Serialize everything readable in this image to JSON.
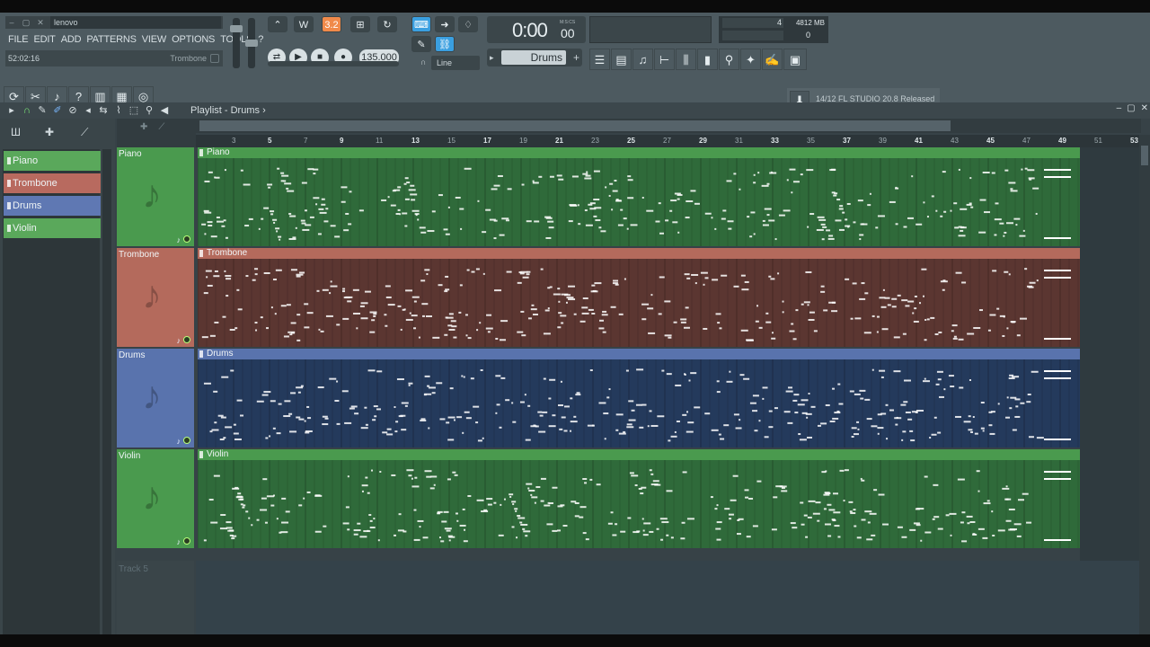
{
  "window": {
    "title": "lenovo",
    "hint_time": "52:02:16",
    "hint_name": "Trombone"
  },
  "menu": [
    "FILE",
    "EDIT",
    "ADD",
    "PATTERNS",
    "VIEW",
    "OPTIONS",
    "TOOLS",
    "?"
  ],
  "transport": {
    "pattern_song": "3.2",
    "tempo": "135.000",
    "time": "0:00",
    "time_small": "00",
    "time_unit": "M:S:CS",
    "snap": "Line",
    "pattern_name": "Drums"
  },
  "cpu": {
    "poly": "4",
    "memory": "4812 MB",
    "cpu_val": "0"
  },
  "news": {
    "text": "14/12  FL STUDIO 20.8 Released"
  },
  "playlist": {
    "title": "Playlist - Drums",
    "arrow": "›"
  },
  "picker": {
    "items": [
      {
        "label": "Piano",
        "color": "#5aa85b"
      },
      {
        "label": "Trombone",
        "color": "#b86a5f"
      },
      {
        "label": "Drums",
        "color": "#5f78b3"
      },
      {
        "label": "Violin",
        "color": "#5aa85b"
      }
    ]
  },
  "ruler": [
    "3",
    "5",
    "7",
    "9",
    "11",
    "13",
    "15",
    "17",
    "19",
    "21",
    "23",
    "25",
    "27",
    "29",
    "31",
    "33",
    "35",
    "37",
    "39",
    "41",
    "43",
    "45",
    "47",
    "49",
    "51",
    "53"
  ],
  "tracks": [
    {
      "name": "Piano",
      "clip": "Piano",
      "color": "#4a9a4e",
      "body": "#2f6a3a"
    },
    {
      "name": "Trombone",
      "clip": "Trombone",
      "color": "#b46a5c",
      "body": "#5b3631"
    },
    {
      "name": "Drums",
      "clip": "Drums",
      "color": "#5973ad",
      "body": "#243a5c"
    },
    {
      "name": "Violin",
      "clip": "Violin",
      "color": "#4a9a4e",
      "body": "#2f6a3a"
    }
  ],
  "track5": "Track 5"
}
